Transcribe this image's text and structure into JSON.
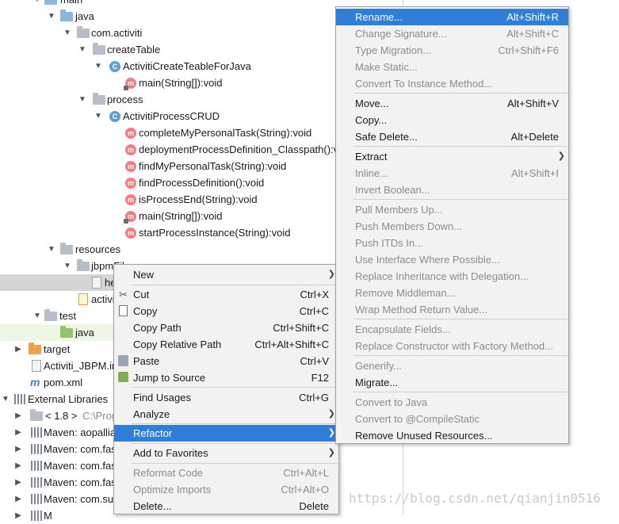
{
  "tree": {
    "r0": "main",
    "r1": "java",
    "r2": "com.activiti",
    "r3": "createTable",
    "r4": "ActivitiCreateTeableForJava",
    "r5": "main(String[]):void",
    "r6": "process",
    "r7": "ActivitiProcessCRUD",
    "r8": "completeMyPersonalTask(String):void",
    "r9": "deploymentProcessDefinition_Classpath():v",
    "r10": "findMyPersonalTask(String):void",
    "r11": "findProcessDefinition():void",
    "r12": "isProcessEnd(String):void",
    "r13": "main(String[]):void",
    "r14": "startProcessInstance(String):void",
    "r15": "resources",
    "r16": "jbpmFil",
    "r17": "he",
    "r18": "activi",
    "r19": "test",
    "r20": "java",
    "r21": "target",
    "r22": "Activiti_JBPM.im",
    "r23": "pom.xml",
    "r24": "External Libraries",
    "r25": "< 1.8 >",
    "r25b": "C:\\Prog",
    "r26": "Maven: aopallia",
    "r27": "Maven: com.fas",
    "r28": "Maven: com.fas",
    "r29": "Maven: com.fas",
    "r30": "Maven: com.su",
    "r31": "M"
  },
  "context_menu": {
    "new": "New",
    "cut": "Cut",
    "cut_key": "Ctrl+X",
    "copy": "Copy",
    "copy_key": "Ctrl+C",
    "copy_path": "Copy Path",
    "copy_path_key": "Ctrl+Shift+C",
    "copy_rel": "Copy Relative Path",
    "copy_rel_key": "Ctrl+Alt+Shift+C",
    "paste": "Paste",
    "paste_key": "Ctrl+V",
    "jump": "Jump to Source",
    "jump_key": "F12",
    "find_usages": "Find Usages",
    "find_usages_key": "Ctrl+G",
    "analyze": "Analyze",
    "refactor": "Refactor",
    "favorites": "Add to Favorites",
    "reformat": "Reformat Code",
    "reformat_key": "Ctrl+Alt+L",
    "optimize": "Optimize Imports",
    "optimize_key": "Ctrl+Alt+O",
    "delete": "Delete...",
    "delete_key": "Delete"
  },
  "refactor_menu": {
    "rename": "Rename...",
    "rename_key": "Alt+Shift+R",
    "change_sig": "Change Signature...",
    "change_sig_key": "Alt+Shift+C",
    "type_mig": "Type Migration...",
    "type_mig_key": "Ctrl+Shift+F6",
    "make_static": "Make Static...",
    "convert_instance": "Convert To Instance Method...",
    "move": "Move...",
    "move_key": "Alt+Shift+V",
    "copy": "Copy...",
    "safe_delete": "Safe Delete...",
    "safe_delete_key": "Alt+Delete",
    "extract": "Extract",
    "inline": "Inline...",
    "inline_key": "Alt+Shift+I",
    "invert_bool": "Invert Boolean...",
    "pull_up": "Pull Members Up...",
    "push_down": "Push Members Down...",
    "push_itds": "Push ITDs In...",
    "use_interface": "Use Interface Where Possible...",
    "replace_inherit": "Replace Inheritance with Delegation...",
    "remove_middleman": "Remove Middleman...",
    "wrap_return": "Wrap Method Return Value...",
    "encapsulate": "Encapsulate Fields...",
    "replace_ctor": "Replace Constructor with Factory Method...",
    "generify": "Generify...",
    "migrate": "Migrate...",
    "convert_java": "Convert to Java",
    "convert_compile": "Convert to @CompileStatic",
    "remove_unused": "Remove Unused Resources..."
  },
  "watermark": "https://blog.csdn.net/qianjin0516",
  "colors": {
    "highlight": "#2f7fd8",
    "menu_bg": "#f2f2f2",
    "disabled": "#8c8c8c"
  }
}
